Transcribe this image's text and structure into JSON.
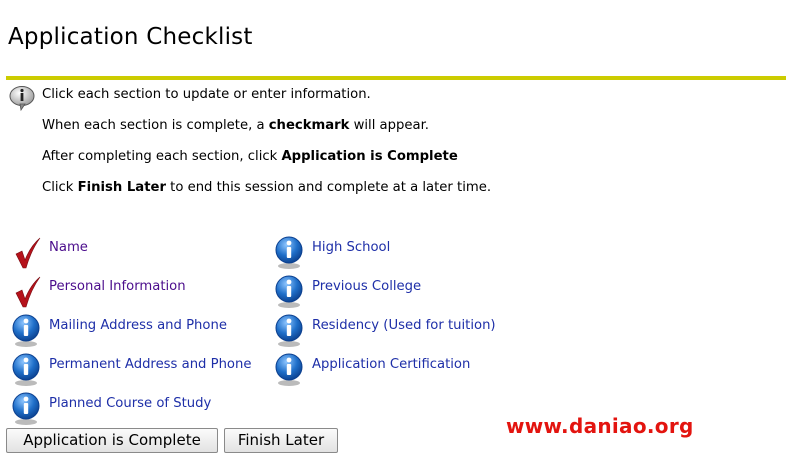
{
  "page": {
    "title": "Application Checklist"
  },
  "instructions": {
    "line1": "Click each section to update or enter information.",
    "line2_pre": "When each section is complete, a ",
    "line2_bold": "checkmark",
    "line2_post": " will appear.",
    "line3_pre": "After completing each section, click ",
    "line3_bold": "Application is Complete",
    "line4_pre": "Click ",
    "line4_bold": "Finish Later",
    "line4_post": " to end this session and complete at a later time."
  },
  "sections": {
    "left": [
      {
        "label": "Name",
        "status": "complete",
        "icon": "checkmark-icon"
      },
      {
        "label": "Personal Information",
        "status": "complete",
        "icon": "checkmark-icon"
      },
      {
        "label": "Mailing Address and Phone",
        "status": "pending",
        "icon": "info-icon"
      },
      {
        "label": "Permanent Address and Phone",
        "status": "pending",
        "icon": "info-icon"
      },
      {
        "label": "Planned Course of Study",
        "status": "pending",
        "icon": "info-icon"
      }
    ],
    "right": [
      {
        "label": "High School",
        "status": "pending",
        "icon": "info-icon"
      },
      {
        "label": "Previous College",
        "status": "pending",
        "icon": "info-icon"
      },
      {
        "label": "Residency (Used for tuition)",
        "status": "pending",
        "icon": "info-icon"
      },
      {
        "label": "Application Certification",
        "status": "pending",
        "icon": "info-icon"
      }
    ]
  },
  "buttons": {
    "complete": "Application is Complete",
    "finish_later": "Finish Later"
  },
  "watermark": "www.daniao.org",
  "colors": {
    "rule": "#cccc00",
    "link_visited": "#4b0d8c",
    "link": "#1e2fa8",
    "checkmark": "#b5121b",
    "info_blue": "#1f6fc9",
    "watermark": "#e3140f"
  }
}
